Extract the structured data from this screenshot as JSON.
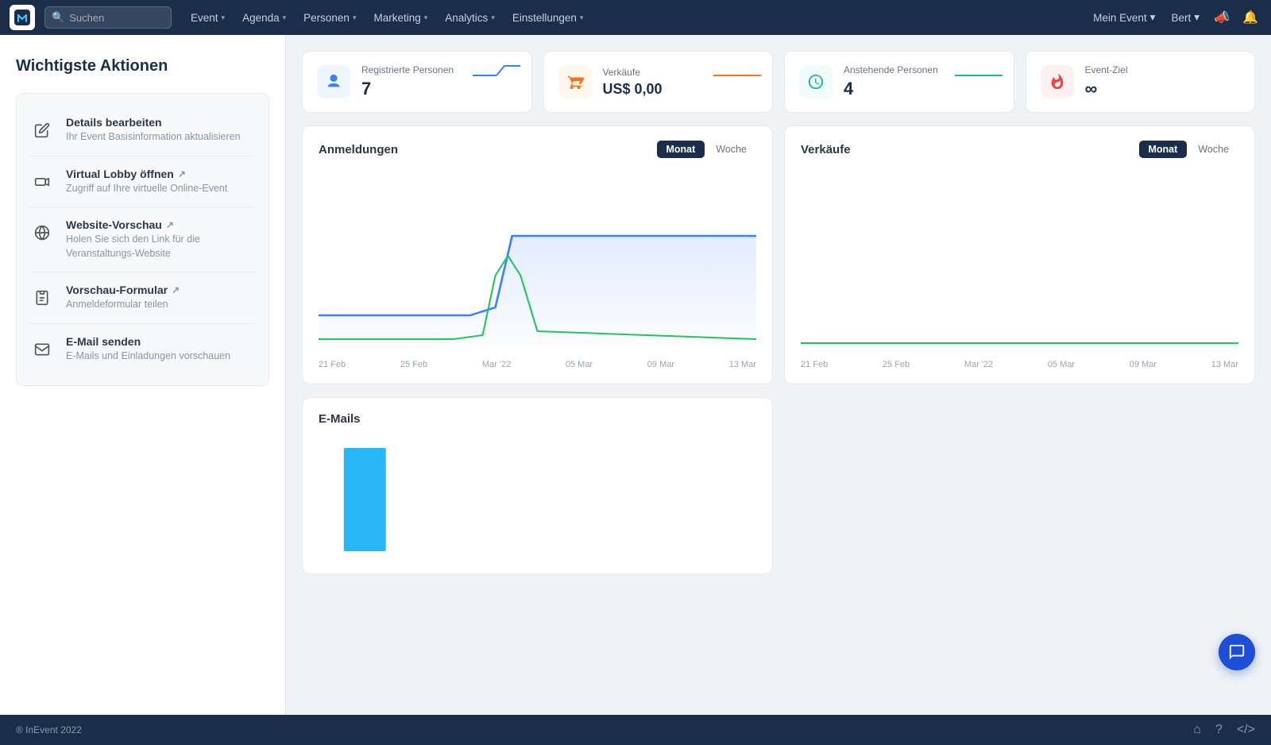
{
  "nav": {
    "search_placeholder": "Suchen",
    "items": [
      {
        "label": "Event",
        "has_chevron": true
      },
      {
        "label": "Agenda",
        "has_chevron": true
      },
      {
        "label": "Personen",
        "has_chevron": true
      },
      {
        "label": "Marketing",
        "has_chevron": true
      },
      {
        "label": "Analytics",
        "has_chevron": true
      },
      {
        "label": "Einstellungen",
        "has_chevron": true
      }
    ],
    "right": {
      "event_label": "Mein Event",
      "user_label": "Bert"
    }
  },
  "sidebar": {
    "title": "Wichtigste Aktionen",
    "items": [
      {
        "icon": "✏️",
        "title": "Details bearbeiten",
        "desc": "Ihr Event Basisinformation aktualisieren",
        "external": false
      },
      {
        "icon": "📹",
        "title": "Virtual Lobby öffnen",
        "desc": "Zugriff auf Ihre virtuelle Online-Event",
        "external": true
      },
      {
        "icon": "🌐",
        "title": "Website-Vorschau",
        "desc": "Holen Sie sich den Link für die Veranstaltungs-Website",
        "external": true
      },
      {
        "icon": "📋",
        "title": "Vorschau-Formular",
        "desc": "Anmeldeformular teilen",
        "external": true
      },
      {
        "icon": "✉️",
        "title": "E-Mail senden",
        "desc": "E-Mails und Einladungen vorschauen",
        "external": false
      }
    ]
  },
  "stats": [
    {
      "label": "Registrierte Personen",
      "value": "7",
      "suffix": "-",
      "icon_type": "blue",
      "icon": "person"
    },
    {
      "label": "Verkäufe",
      "value": "US$ 0,00",
      "suffix": "-",
      "icon_type": "orange",
      "icon": "cart"
    },
    {
      "label": "Anstehende Personen",
      "value": "4",
      "suffix": "-",
      "icon_type": "teal",
      "icon": "clock"
    },
    {
      "label": "Event-Ziel",
      "value": "∞",
      "suffix": "",
      "icon_type": "red",
      "icon": "fire"
    }
  ],
  "charts": {
    "anmeldungen": {
      "title": "Anmeldungen",
      "tabs": [
        "Monat",
        "Woche"
      ],
      "active_tab": "Monat",
      "x_labels": [
        "21 Feb",
        "25 Feb",
        "Mar '22",
        "05 Mar",
        "09 Mar",
        "13 Mar"
      ]
    },
    "verkaeufe": {
      "title": "Verkäufe",
      "tabs": [
        "Monat",
        "Woche"
      ],
      "active_tab": "Monat",
      "x_labels": [
        "21 Feb",
        "25 Feb",
        "Mar '22",
        "05 Mar",
        "09 Mar",
        "13 Mar"
      ]
    },
    "emails": {
      "title": "E-Mails",
      "tabs": [],
      "x_labels": []
    }
  },
  "footer": {
    "copyright": "® InEvent 2022"
  },
  "chat_button": {
    "icon": "💬"
  }
}
